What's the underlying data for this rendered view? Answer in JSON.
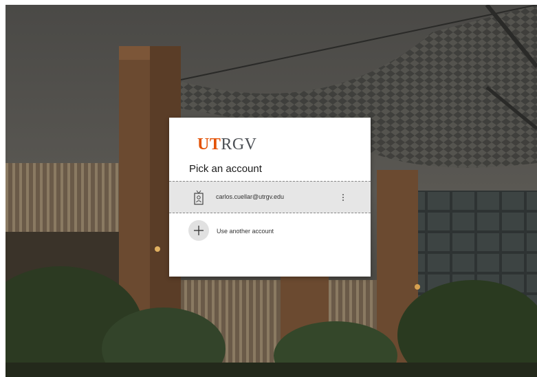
{
  "brand": {
    "logo_ut": "UT",
    "logo_rgv": "RGV",
    "accent_color": "#e35205",
    "secondary_color": "#4b4f54"
  },
  "dialog": {
    "title": "Pick an account",
    "accounts": [
      {
        "email": "carlos.cuellar@utrgv.edu",
        "icon": "badge-icon",
        "menu_icon": "more-options-icon"
      }
    ],
    "add_account": {
      "label": "Use another account",
      "icon": "plus-icon"
    }
  }
}
